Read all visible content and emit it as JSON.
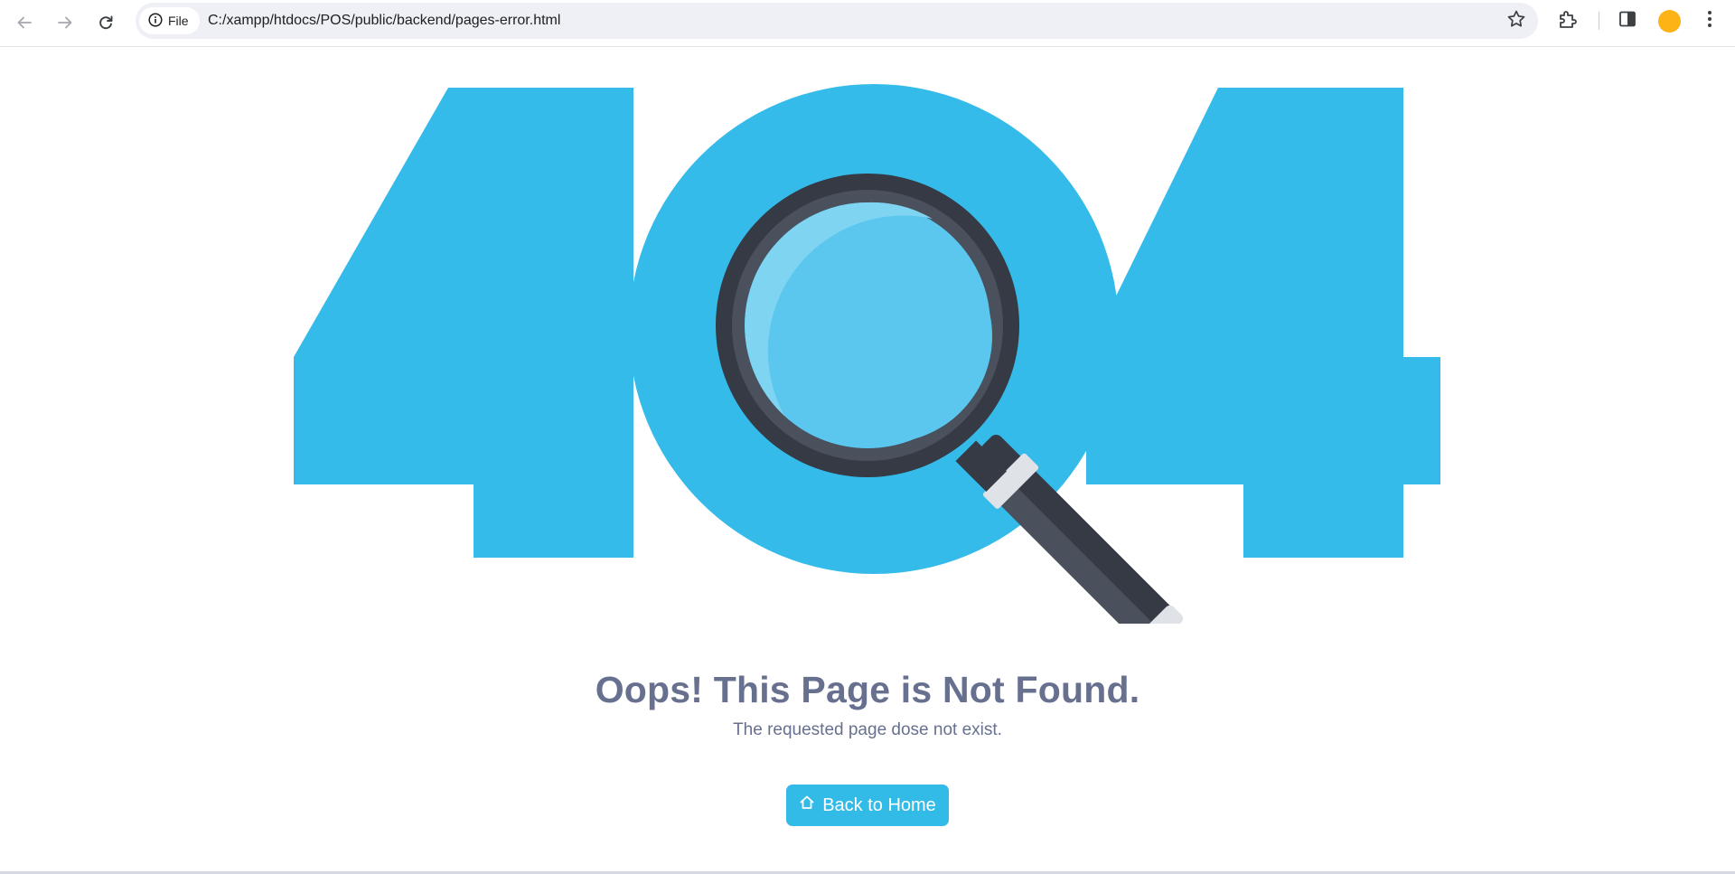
{
  "browser": {
    "chip_label": "File",
    "url": "C:/xampp/htdocs/POS/public/backend/pages-error.html",
    "avatar_color": "#fbb316"
  },
  "illustration": {
    "digits": "404",
    "primary_color": "#35bbea",
    "icon": "magnifying-glass"
  },
  "page": {
    "heading": "Oops! This Page is Not Found.",
    "subtext": "The requested page dose not exist.",
    "button_label": "Back to Home",
    "button_icon": "home-icon",
    "button_color": "#33bbe8",
    "text_color": "#67708f"
  }
}
